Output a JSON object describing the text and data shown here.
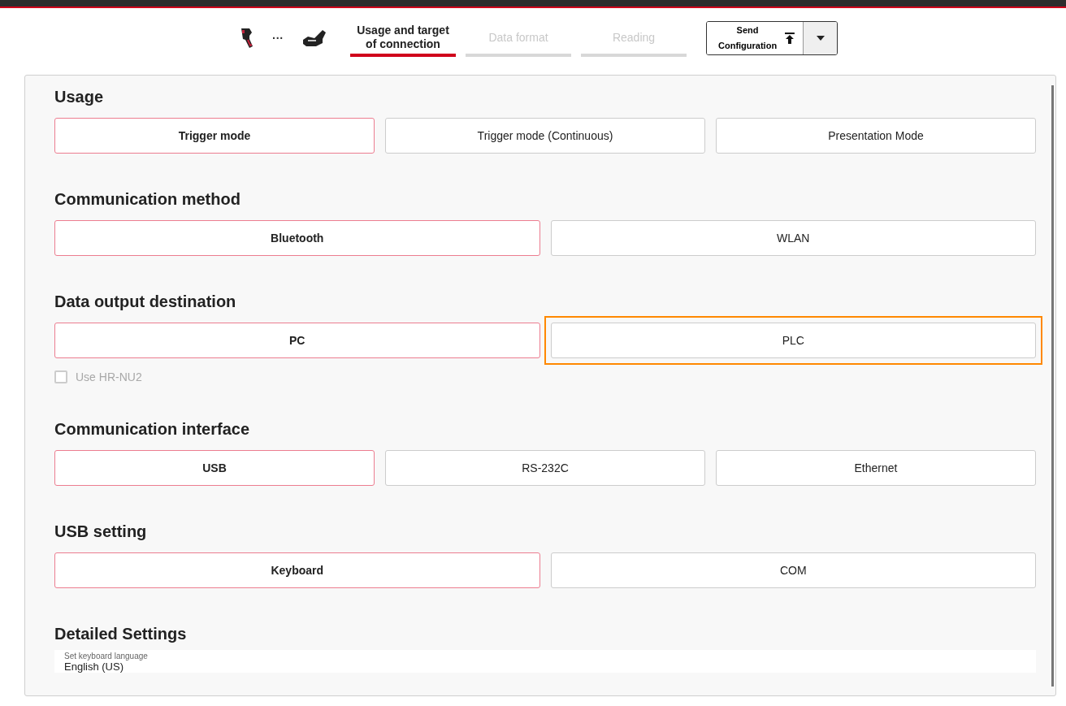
{
  "steps": [
    {
      "kind": "scanner"
    },
    {
      "kind": "more",
      "label": "···"
    },
    {
      "kind": "cradle"
    }
  ],
  "tabs": [
    {
      "label": "Usage and target of connection",
      "selected": true,
      "disabled": false
    },
    {
      "label": "Data format",
      "selected": false,
      "disabled": true
    },
    {
      "label": "Reading",
      "selected": false,
      "disabled": true
    }
  ],
  "send_button": {
    "label_line1": "Send",
    "label_line2": "Configuration"
  },
  "sections": [
    {
      "title": "Usage",
      "options": [
        {
          "label": "Trigger mode",
          "selected": true,
          "highlighted": false
        },
        {
          "label": "Trigger mode (Continuous)",
          "selected": false,
          "highlighted": false
        },
        {
          "label": "Presentation Mode",
          "selected": false,
          "highlighted": false
        }
      ]
    },
    {
      "title": "Communication method",
      "options": [
        {
          "label": "Bluetooth",
          "selected": true,
          "highlighted": false
        },
        {
          "label": "WLAN",
          "selected": false,
          "highlighted": false
        }
      ]
    },
    {
      "title": "Data output destination",
      "options": [
        {
          "label": "PC",
          "selected": true,
          "highlighted": false
        },
        {
          "label": "PLC",
          "selected": false,
          "highlighted": true
        }
      ],
      "checkbox": {
        "label": "Use HR-NU2",
        "checked": false,
        "disabled": true
      }
    },
    {
      "title": "Communication interface",
      "options": [
        {
          "label": "USB",
          "selected": true,
          "highlighted": false
        },
        {
          "label": "RS-232C",
          "selected": false,
          "highlighted": false
        },
        {
          "label": "Ethernet",
          "selected": false,
          "highlighted": false
        }
      ]
    },
    {
      "title": "USB setting",
      "options": [
        {
          "label": "Keyboard",
          "selected": true,
          "highlighted": false
        },
        {
          "label": "COM",
          "selected": false,
          "highlighted": false
        }
      ]
    },
    {
      "title": "Detailed Settings",
      "select": {
        "label": "Set keyboard language",
        "value": "English (US)"
      }
    }
  ]
}
